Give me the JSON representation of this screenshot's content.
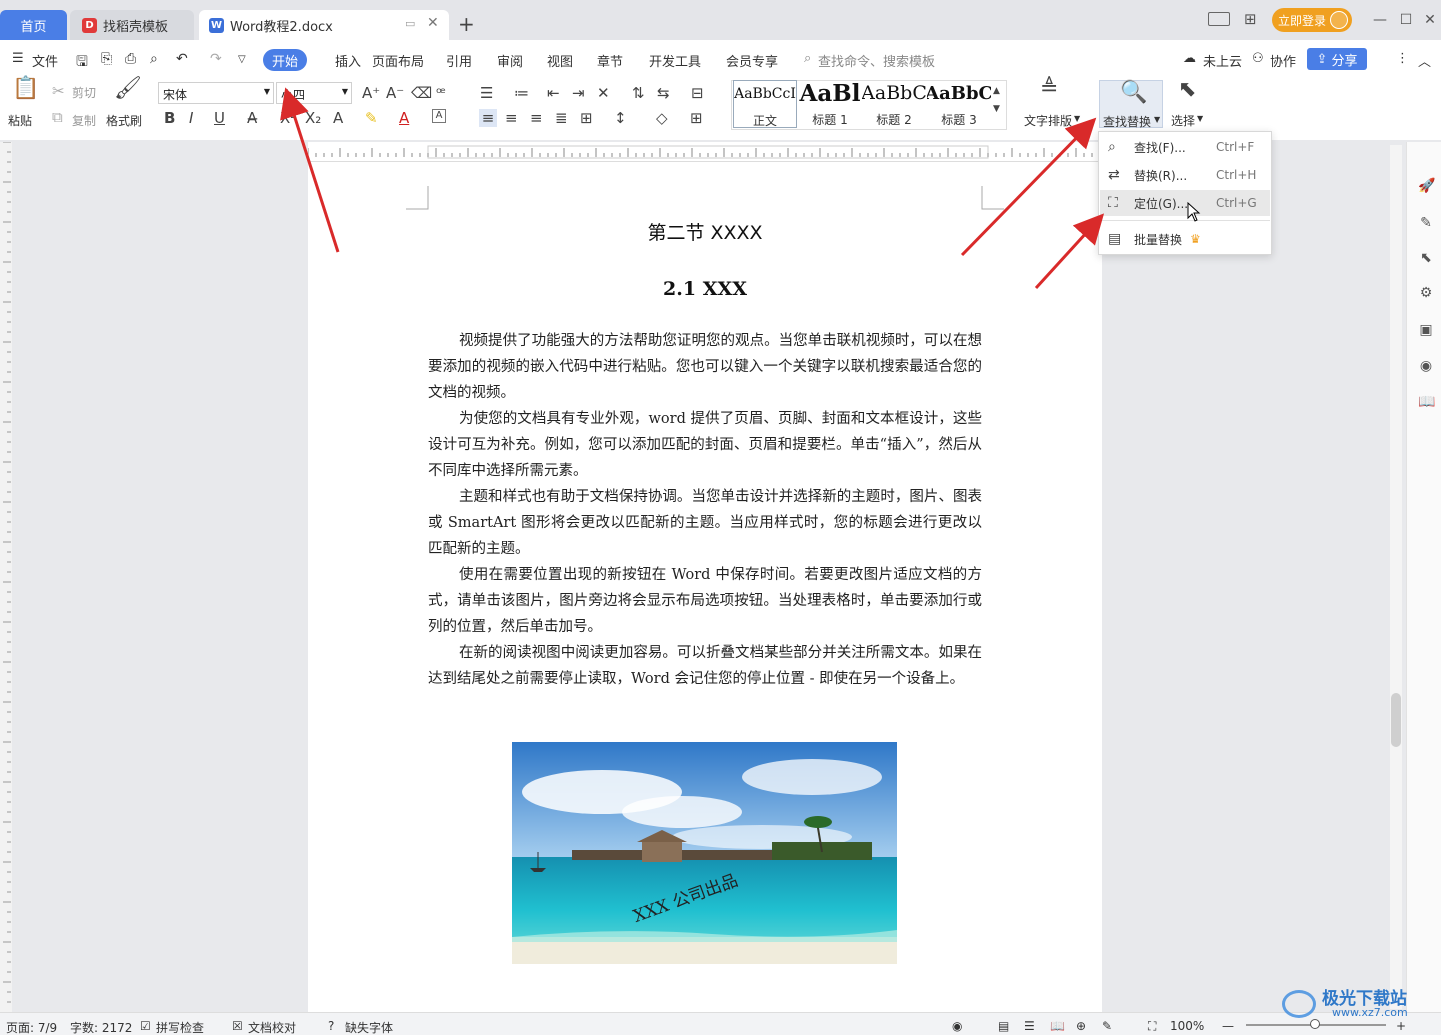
{
  "tabs": {
    "home": "首页",
    "template": "找稻壳模板",
    "doc": "Word教程2.docx",
    "new_tab": "+"
  },
  "titlebar": {
    "login": "立即登录"
  },
  "menubar": {
    "file": "文件",
    "items": [
      "开始",
      "插入",
      "页面布局",
      "引用",
      "审阅",
      "视图",
      "章节",
      "开发工具",
      "会员专享"
    ],
    "search_placeholder": "查找命令、搜索模板",
    "cloud": "未上云",
    "collab": "协作",
    "share": "分享"
  },
  "ribbon": {
    "paste": "粘贴",
    "cut": "剪切",
    "copy": "复制",
    "format_painter": "格式刷",
    "font_name": "宋体",
    "font_size": "小四",
    "styles": [
      {
        "sample": "AaBbCcI",
        "label": "正文"
      },
      {
        "sample": "AaBl",
        "label": "标题 1"
      },
      {
        "sample": "AaBbC",
        "label": "标题 2"
      },
      {
        "sample": "AaBbC",
        "label": "标题 3"
      }
    ],
    "text_layout": "文字排版",
    "find_replace": "查找替换",
    "select": "选择"
  },
  "dropdown": {
    "items": [
      {
        "label": "查找(F)...",
        "shortcut": "Ctrl+F",
        "icon": "search-icon"
      },
      {
        "label": "替换(R)...",
        "shortcut": "Ctrl+H",
        "icon": "replace-icon"
      },
      {
        "label": "定位(G)...",
        "shortcut": "Ctrl+G",
        "icon": "locate-icon"
      },
      {
        "label": "批量替换",
        "shortcut": "",
        "icon": "batch-replace-icon"
      }
    ]
  },
  "document": {
    "section_title": "第二节  XXXX",
    "heading": "2.1 XXX",
    "paragraphs": [
      "视频提供了功能强大的方法帮助您证明您的观点。当您单击联机视频时，可以在想要添加的视频的嵌入代码中进行粘贴。您也可以键入一个关键字以联机搜索最适合您的文档的视频。",
      "为使您的文档具有专业外观，word 提供了页眉、页脚、封面和文本框设计，这些设计可互为补充。例如，您可以添加匹配的封面、页眉和提要栏。单击“插入”，然后从不同库中选择所需元素。",
      "主题和样式也有助于文档保持协调。当您单击设计并选择新的主题时，图片、图表或 SmartArt 图形将会更改以匹配新的主题。当应用样式时，您的标题会进行更改以匹配新的主题。",
      "使用在需要位置出现的新按钮在 Word 中保存时间。若要更改图片适应文档的方式，请单击该图片，图片旁边将会显示布局选项按钮。当处理表格时，单击要添加行或列的位置，然后单击加号。",
      "在新的阅读视图中阅读更加容易。可以折叠文档某些部分并关注所需文本。如果在达到结尾处之前需要停止读取，Word 会记住您的停止位置 - 即使在另一个设备上。"
    ],
    "image_watermark": "XXX 公司出品"
  },
  "statusbar": {
    "page": "页面: 7/9",
    "words": "字数: 2172",
    "spell": "拼写检查",
    "proof": "文档校对",
    "missing_font": "缺失字体",
    "zoom": "100%"
  },
  "watermark_site": {
    "brand": "极光下载站",
    "url": "www.xz7.com"
  },
  "colors": {
    "accent": "#4a7ee6",
    "login": "#f0a020",
    "arrow": "#d92a2a"
  }
}
